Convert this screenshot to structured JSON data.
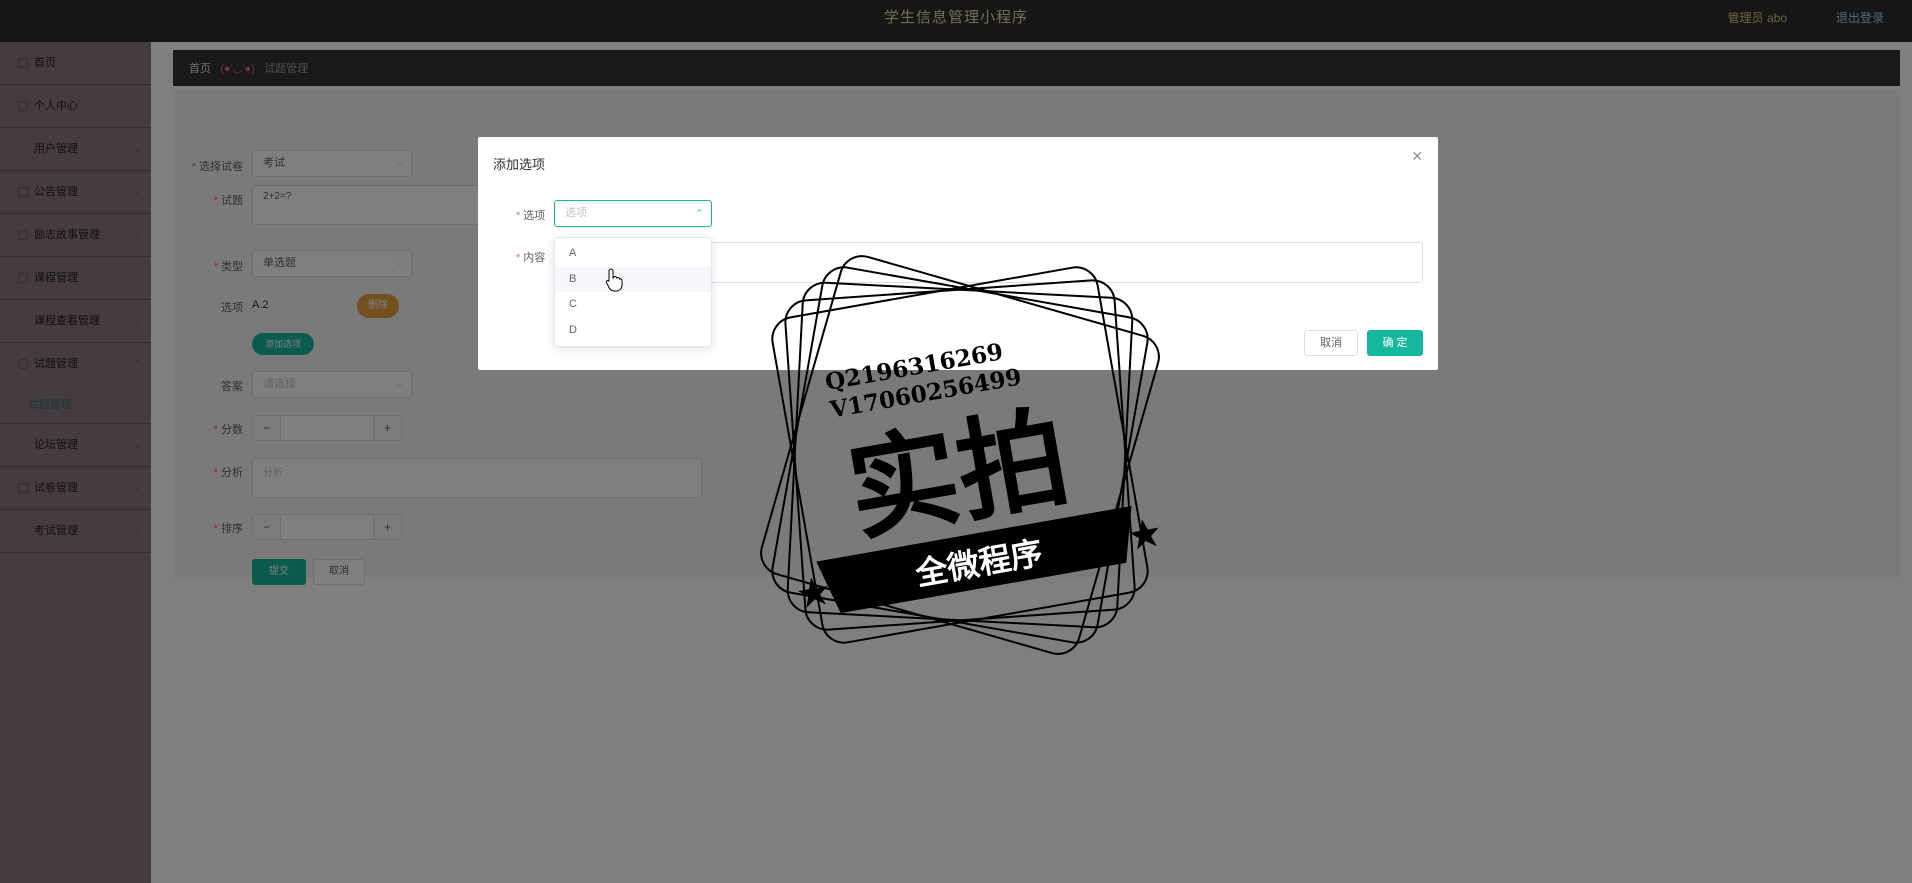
{
  "header": {
    "title": "学生信息管理小程序",
    "user": "管理员 abo",
    "logout": "退出登录"
  },
  "sidebar": {
    "items": [
      {
        "label": "首页"
      },
      {
        "label": "个人中心"
      },
      {
        "label": "用户管理"
      },
      {
        "label": "公告管理"
      },
      {
        "label": "励志故事管理"
      },
      {
        "label": "课程管理"
      },
      {
        "label": "课程查看管理"
      },
      {
        "label": "试题管理"
      },
      {
        "label": "试题管理"
      },
      {
        "label": "论坛管理"
      },
      {
        "label": "试卷管理"
      },
      {
        "label": "考试管理"
      }
    ]
  },
  "breadcrumb": {
    "home": "首页",
    "separator": "(●'◡'●)",
    "current": "试题管理"
  },
  "form": {
    "paper": {
      "label": "选择试卷",
      "value": "考试"
    },
    "question": {
      "label": "试题",
      "value": "2+2=?"
    },
    "type": {
      "label": "类型",
      "value": "单选题"
    },
    "options": {
      "label": "选项",
      "value": "A.2",
      "delete_label": "删除",
      "add_label": "添加选项"
    },
    "answer": {
      "label": "答案",
      "placeholder": "请选择"
    },
    "score": {
      "label": "分数",
      "value": ""
    },
    "analysis": {
      "label": "分析",
      "placeholder": "分析"
    },
    "order": {
      "label": "排序",
      "value": ""
    },
    "submit_label": "提交",
    "cancel_label": "取消"
  },
  "dialog": {
    "title": "添加选项",
    "option_label": "选项",
    "option_placeholder": "选项",
    "content_label": "内容",
    "cancel_label": "取消",
    "confirm_label": "确 定",
    "dropdown_options": [
      "A",
      "B",
      "C",
      "D"
    ],
    "hovered_option": "B"
  },
  "watermark": {
    "line1": "Q2196316269",
    "line2": "V17060256499",
    "main": "实拍",
    "banner": "全微程序"
  },
  "colors": {
    "header_bg": "#2d2d2d",
    "sidebar_bg": "#8a7a7a",
    "accent": "#16b79f",
    "delete_button": "#e6a23c"
  }
}
